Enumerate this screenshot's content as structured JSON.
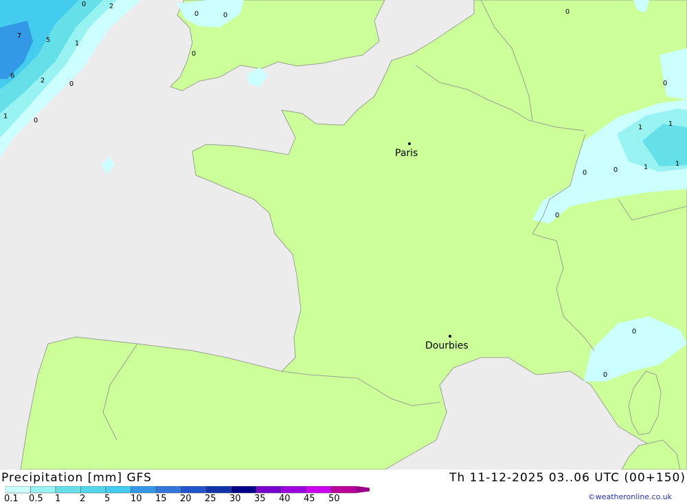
{
  "map": {
    "colors": {
      "sea": "#ececec",
      "land": "#ccff99",
      "border": "#9aa090",
      "p01": "#ccffff",
      "p05": "#99f2f2",
      "p1": "#66e0e8",
      "p2": "#44ccee",
      "p5": "#3399e6"
    },
    "cities": [
      {
        "name": "Paris"
      },
      {
        "name": "Dourbies"
      }
    ],
    "precip_values": [
      "0",
      "2",
      "7",
      "5",
      "1",
      "6",
      "2",
      "0",
      "1",
      "0",
      "0",
      "0",
      "0",
      "0",
      "0",
      "1",
      "1",
      "0",
      "0",
      "1",
      "1",
      "0",
      "0",
      "0"
    ]
  },
  "footer": {
    "title": "Precipitation [mm] GFS",
    "timestamp": "Th 11-12-2025 03..06 UTC (00+150)",
    "credit": "©weatheronline.co.uk"
  },
  "legend": {
    "ticks": [
      "0.1",
      "0.5",
      "1",
      "2",
      "5",
      "10",
      "15",
      "20",
      "25",
      "30",
      "35",
      "40",
      "45",
      "50"
    ],
    "colors": [
      "#ccffff",
      "#99f2f2",
      "#66e0e8",
      "#55d6ec",
      "#44ccee",
      "#3399e6",
      "#3377dd",
      "#2255cc",
      "#1133aa",
      "#000088",
      "#7700cc",
      "#9900dd",
      "#cc00ee",
      "#bb0099",
      "#990088"
    ]
  }
}
